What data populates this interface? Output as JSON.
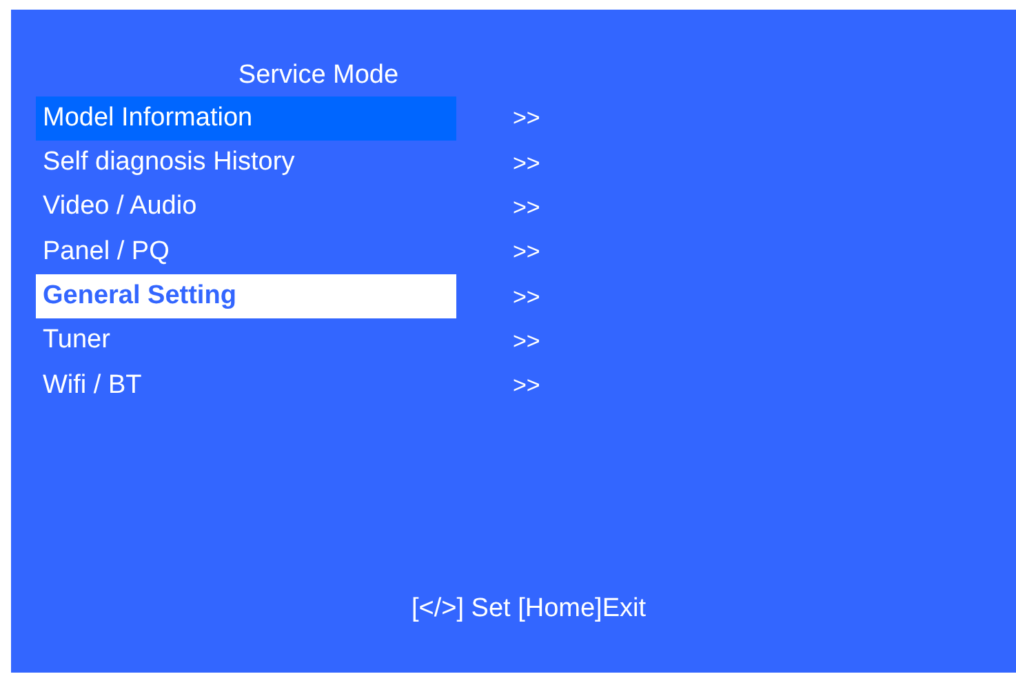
{
  "title": "Service Mode",
  "menu": [
    {
      "label": "Model Information",
      "arrow": ">>",
      "selected": false,
      "focused": true
    },
    {
      "label": "Self diagnosis History",
      "arrow": ">>",
      "selected": false,
      "focused": false
    },
    {
      "label": "Video / Audio",
      "arrow": ">>",
      "selected": false,
      "focused": false
    },
    {
      "label": "Panel / PQ",
      "arrow": ">>",
      "selected": false,
      "focused": false
    },
    {
      "label": "General Setting",
      "arrow": ">>",
      "selected": true,
      "focused": false
    },
    {
      "label": "Tuner",
      "arrow": ">>",
      "selected": false,
      "focused": false
    },
    {
      "label": "Wifi / BT",
      "arrow": ">>",
      "selected": false,
      "focused": false
    }
  ],
  "footer": "[</>] Set [Home]Exit"
}
